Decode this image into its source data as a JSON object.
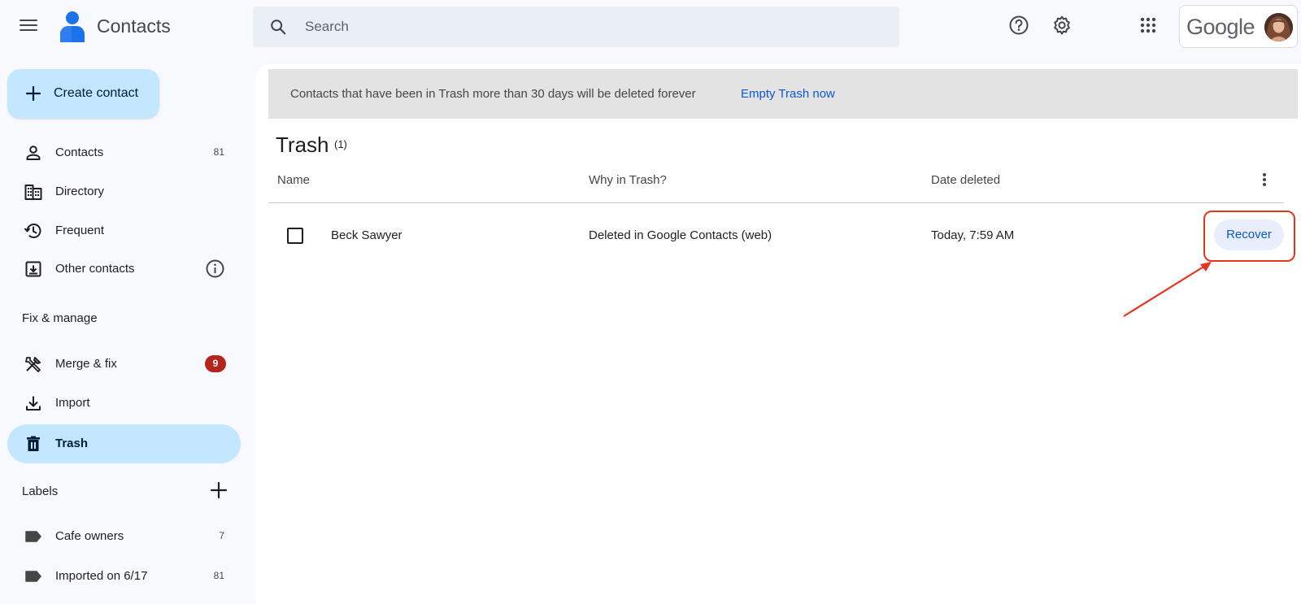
{
  "header": {
    "app_title": "Contacts",
    "search_placeholder": "Search",
    "account_brand": "Google"
  },
  "sidebar": {
    "create_label": "Create contact",
    "items": [
      {
        "label": "Contacts",
        "count": "81",
        "icon": "person-icon"
      },
      {
        "label": "Directory",
        "icon": "building-icon"
      },
      {
        "label": "Frequent",
        "icon": "history-icon"
      },
      {
        "label": "Other contacts",
        "icon": "archive-download-icon"
      }
    ],
    "fix_manage_heading": "Fix & manage",
    "fix_items": [
      {
        "label": "Merge & fix",
        "badge": "9",
        "icon": "merge-fix-icon"
      },
      {
        "label": "Import",
        "icon": "download-icon"
      },
      {
        "label": "Trash",
        "icon": "trash-icon",
        "active": true
      }
    ],
    "labels_heading": "Labels",
    "labels": [
      {
        "label": "Cafe owners",
        "count": "7"
      },
      {
        "label": "Imported on 6/17",
        "count": "81"
      }
    ]
  },
  "banner": {
    "message": "Contacts that have been in Trash more than 30 days will be deleted forever",
    "action": "Empty Trash now"
  },
  "main": {
    "title": "Trash",
    "count": "(1)",
    "columns": [
      "Name",
      "Why in Trash?",
      "Date deleted"
    ],
    "rows": [
      {
        "name": "Beck Sawyer",
        "reason": "Deleted in Google Contacts (web)",
        "date": "Today, 7:59 AM",
        "action": "Recover"
      }
    ]
  },
  "colors": {
    "accent": "#0b57d0",
    "active_nav": "#c2e7ff",
    "badge": "#b3261e",
    "annotation": "#e8341c"
  }
}
